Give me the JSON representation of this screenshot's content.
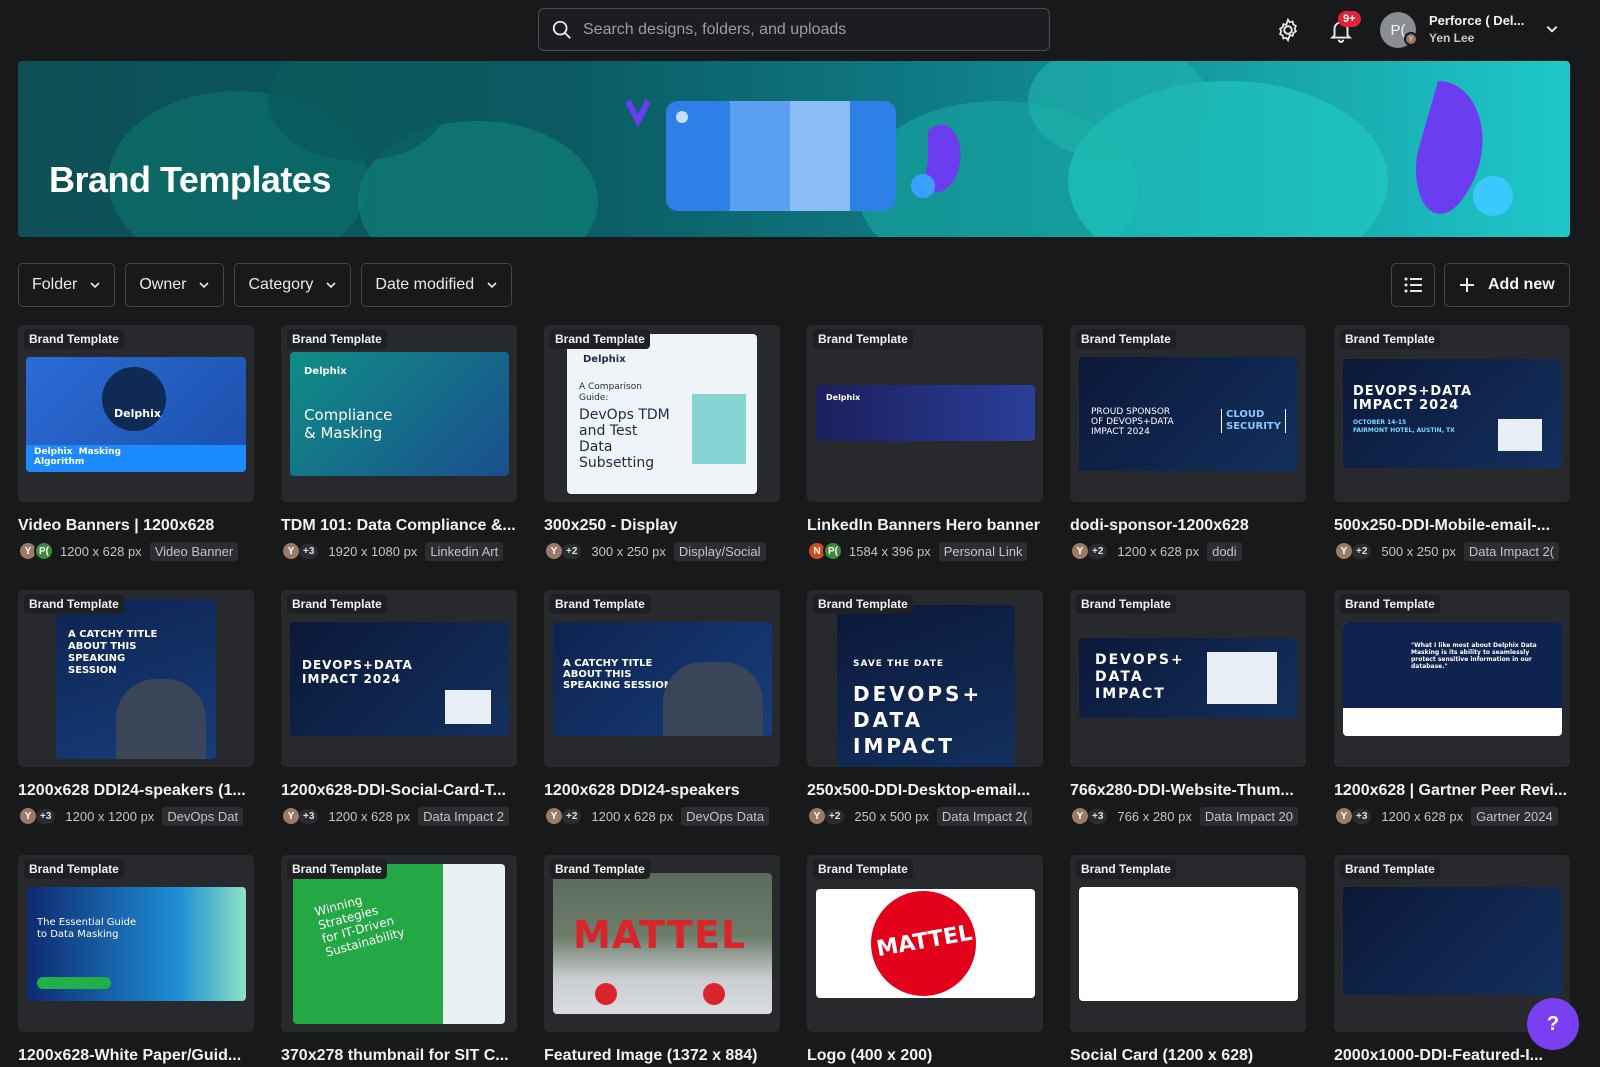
{
  "search": {
    "placeholder": "Search designs, folders, and uploads"
  },
  "notifications": {
    "badge": "9+"
  },
  "account": {
    "initials": "P(",
    "mini_initial": "Y",
    "org": "Perforce ( Del...",
    "user": "Yen Lee"
  },
  "hero": {
    "title": "Brand Templates"
  },
  "filters": [
    "Folder",
    "Owner",
    "Category",
    "Date modified"
  ],
  "add_new": "Add new",
  "badge_label": "Brand Template",
  "colors": {
    "accent": "#7b3ff2",
    "badge_red": "#e0213a",
    "background": "#18191b"
  },
  "cards": [
    {
      "title": "Video Banners  | 1200x628",
      "avatars": [
        "Y",
        "P("
      ],
      "more": "",
      "dims": "1200 x 628 px",
      "category": "Video Banner"
    },
    {
      "title": "TDM 101: Data Compliance &...",
      "avatars": [
        "Y"
      ],
      "more": "+3",
      "dims": "1920 x 1080 px",
      "category": "Linkedin Art"
    },
    {
      "title": "300x250 - Display",
      "avatars": [
        "Y"
      ],
      "more": "+2",
      "dims": "300 x 250 px",
      "category": "Display/Social"
    },
    {
      "title": "LinkedIn Banners Hero banner",
      "avatars": [
        "N",
        "P("
      ],
      "more": "",
      "dims": "1584 x 396 px",
      "category": "Personal Link"
    },
    {
      "title": "dodi-sponsor-1200x628",
      "avatars": [
        "Y"
      ],
      "more": "+2",
      "dims": "1200 x 628 px",
      "category": "dodi"
    },
    {
      "title": "500x250-DDI-Mobile-email-...",
      "avatars": [
        "Y"
      ],
      "more": "+2",
      "dims": "500 x 250 px",
      "category": "Data Impact 2("
    },
    {
      "title": "1200x628 DDI24-speakers (1...",
      "avatars": [
        "Y"
      ],
      "more": "+3",
      "dims": "1200 x 1200 px",
      "category": "DevOps Dat"
    },
    {
      "title": "1200x628-DDI-Social-Card-T...",
      "avatars": [
        "Y"
      ],
      "more": "+3",
      "dims": "1200 x 628 px",
      "category": "Data Impact 2"
    },
    {
      "title": "1200x628 DDI24-speakers",
      "avatars": [
        "Y"
      ],
      "more": "+2",
      "dims": "1200 x 628 px",
      "category": "DevOps Data"
    },
    {
      "title": "250x500-DDI-Desktop-email...",
      "avatars": [
        "Y"
      ],
      "more": "+2",
      "dims": "250 x 500 px",
      "category": "Data Impact 2("
    },
    {
      "title": "766x280-DDI-Website-Thum...",
      "avatars": [
        "Y"
      ],
      "more": "+3",
      "dims": "766 x 280 px",
      "category": "Data Impact 20"
    },
    {
      "title": "1200x628 | Gartner Peer Revi...",
      "avatars": [
        "Y"
      ],
      "more": "+3",
      "dims": "1200 x 628 px",
      "category": "Gartner 2024"
    },
    {
      "title": "1200x628-White Paper/Guid...",
      "avatars": [],
      "more": "",
      "dims": "",
      "category": ""
    },
    {
      "title": "370x278  thumbnail for SIT C...",
      "avatars": [],
      "more": "",
      "dims": "",
      "category": ""
    },
    {
      "title": "Featured Image (1372 x 884)",
      "avatars": [],
      "more": "",
      "dims": "",
      "category": ""
    },
    {
      "title": "Logo (400 x 200)",
      "avatars": [],
      "more": "",
      "dims": "",
      "category": ""
    },
    {
      "title": "Social Card (1200 x 628)",
      "avatars": [],
      "more": "",
      "dims": "",
      "category": ""
    },
    {
      "title": "2000x1000-DDI-Featured-I...",
      "avatars": [],
      "more": "",
      "dims": "",
      "category": ""
    }
  ],
  "art_text": {
    "c0": "Delphix",
    "c0b": "Delphix  Masking\nAlgorithm",
    "c1a": "Delphix",
    "c1b": "Compliance\n& Masking",
    "c2a": "Delphix",
    "c2b": "A Comparison\nGuide:",
    "c2c": "DevOps TDM\nand Test\nData\nSubsetting",
    "c3": "Delphix",
    "c4a": "PROUD SPONSOR\nOF DEVOPS+DATA\nIMPACT 2024",
    "c4b": "CLOUD\nSECURITY",
    "c5a": "DEVOPS+DATA\nIMPACT 2024",
    "c5b": "OCTOBER 14-15\nFAIRMONT HOTEL, AUSTIN, TX",
    "c6": "A CATCHY TITLE\nABOUT THIS\nSPEAKING\nSESSION",
    "c7": "DEVOPS+DATA\nIMPACT 2024",
    "c8": "A CATCHY TITLE\nABOUT THIS\nSPEAKING SESSION",
    "c9a": "SAVE THE DATE",
    "c9b": "DEVOPS+\nDATA\nIMPACT",
    "c10": "DEVOPS+\nDATA\nIMPACT",
    "c11": "\"What I like most about Delphix Data Masking is its ability to seamlessly protect sensitive information in our database.\"",
    "c12": "The Essential Guide\nto Data Masking",
    "c13": "Winning\nStrategies\nfor IT-Driven\nSustainability",
    "c14": "MATTEL",
    "c15": "MATTEL"
  },
  "help": "?"
}
